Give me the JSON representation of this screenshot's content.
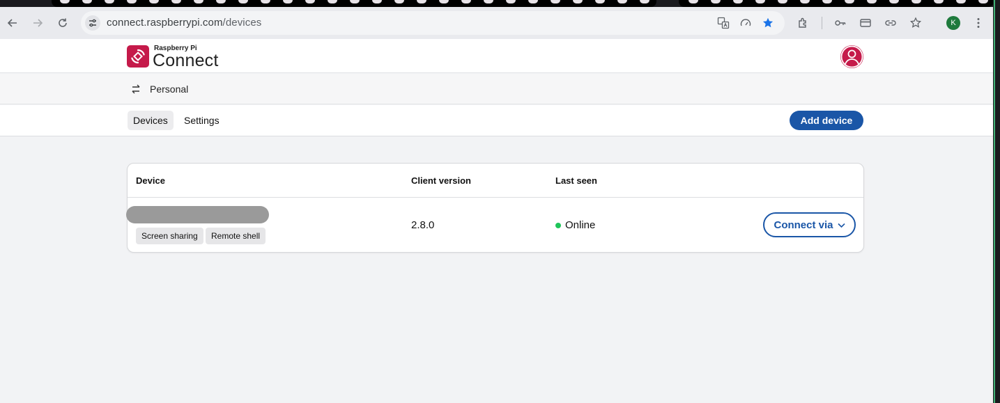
{
  "browser": {
    "url_host": "connect.raspberrypi.com",
    "url_path": "/devices",
    "profile_initial": "K"
  },
  "app": {
    "brand_small": "Raspberry Pi",
    "brand_big": "Connect",
    "workspace": "Personal"
  },
  "nav": {
    "tabs": [
      "Devices",
      "Settings"
    ],
    "active": "Devices",
    "add_device": "Add device"
  },
  "table": {
    "headers": [
      "Device",
      "Client version",
      "Last seen"
    ],
    "rows": [
      {
        "device_name": "",
        "capabilities": [
          "Screen sharing",
          "Remote shell"
        ],
        "client_version": "2.8.0",
        "last_seen": "Online",
        "action": "Connect via"
      }
    ]
  },
  "colors": {
    "brand_red": "#c51a4a",
    "primary_blue": "#1a56a7",
    "online_green": "#1fc55a"
  }
}
